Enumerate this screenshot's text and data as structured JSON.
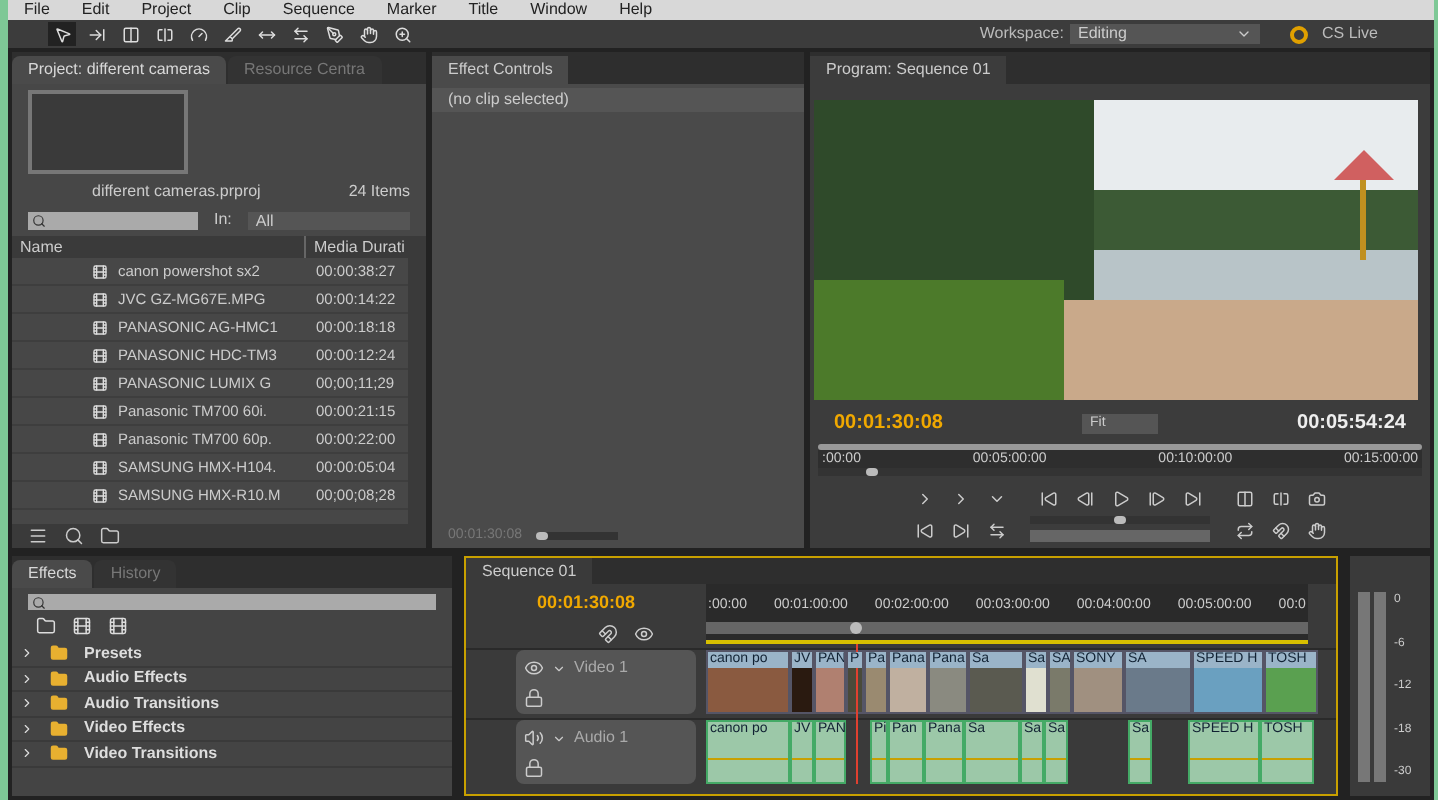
{
  "menu": [
    "File",
    "Edit",
    "Project",
    "Clip",
    "Sequence",
    "Marker",
    "Title",
    "Window",
    "Help"
  ],
  "tools": [
    {
      "kind": "select",
      "selected": true
    },
    {
      "kind": "track",
      "selected": false
    },
    {
      "kind": "ripple",
      "selected": false
    },
    {
      "kind": "rolling",
      "selected": false
    },
    {
      "kind": "rate",
      "selected": false
    },
    {
      "kind": "razor",
      "selected": false
    },
    {
      "kind": "slip",
      "selected": false
    },
    {
      "kind": "slide",
      "selected": false
    },
    {
      "kind": "pen",
      "selected": false
    },
    {
      "kind": "hand",
      "selected": false
    },
    {
      "kind": "zoom",
      "selected": false
    }
  ],
  "workspace": {
    "label": "Workspace:",
    "value": "Editing"
  },
  "cs_live": "CS Live",
  "project": {
    "tabs": [
      {
        "label": "Project: different cameras",
        "selected": true
      },
      {
        "label": "Resource Centra",
        "selected": false
      }
    ],
    "file": "different cameras.prproj",
    "count": "24 Items",
    "in_label": "In:",
    "in_value": "All",
    "columns": [
      "Name",
      "Media Durati"
    ],
    "rows": [
      {
        "name": "canon powershot sx2",
        "duration": "00:00:38:27"
      },
      {
        "name": "JVC GZ-MG67E.MPG",
        "duration": "00:00:14:22"
      },
      {
        "name": "PANASONIC AG-HMC1",
        "duration": "00:00:18:18"
      },
      {
        "name": "PANASONIC HDC-TM3",
        "duration": "00:00:12:24"
      },
      {
        "name": "PANASONIC LUMIX G",
        "duration": "00;00;11;29"
      },
      {
        "name": "Panasonic TM700 60i.",
        "duration": "00:00:21:15"
      },
      {
        "name": "Panasonic TM700 60p.",
        "duration": "00:00:22:00"
      },
      {
        "name": "SAMSUNG HMX-H104.",
        "duration": "00:00:05:04"
      },
      {
        "name": "SAMSUNG HMX-R10.M",
        "duration": "00;00;08;28"
      }
    ]
  },
  "effect_controls": {
    "tab": "Effect Controls",
    "status": "(no clip selected)",
    "timecode": "00:01:30:08",
    "zoom": {
      "level": 0.05
    }
  },
  "program": {
    "tab": "Program: Sequence 01",
    "timecode": "00:01:30:08",
    "fit": "Fit",
    "duration": "00:05:54:24",
    "ruler": [
      ":00:00",
      "00:05:00:00",
      "00:10:00:00",
      "00:15:00:00"
    ],
    "level": 0.09,
    "shuttle": {
      "level": 0.5
    }
  },
  "effects": {
    "tabs": [
      {
        "label": "Effects",
        "selected": true
      },
      {
        "label": "History",
        "selected": false
      }
    ],
    "folders": [
      "Presets",
      "Audio Effects",
      "Audio Transitions",
      "Video Effects",
      "Video Transitions"
    ]
  },
  "sequence": {
    "tab": "Sequence 01",
    "timecode": "00:01:30:08",
    "ruler": [
      ":00:00",
      "00:01:00:00",
      "00:02:00:00",
      "00:03:00:00",
      "00:04:00:00",
      "00:05:00:00",
      "00:0"
    ],
    "level": 0.25,
    "tracks": [
      {
        "kind": "video",
        "name": "Video 1",
        "clips": [
          {
            "kind": "clip",
            "label": "canon po"
          },
          {
            "kind": "clip",
            "label": "JV"
          },
          {
            "kind": "clip",
            "label": "PAN"
          },
          {
            "kind": "clip",
            "label": "P"
          },
          {
            "kind": "clip",
            "label": "Pa"
          },
          {
            "kind": "clip",
            "label": "Pana"
          },
          {
            "kind": "clip",
            "label": "Pana"
          },
          {
            "kind": "clip",
            "label": "Sa"
          },
          {
            "kind": "clip",
            "label": "Sa"
          },
          {
            "kind": "clip",
            "label": "SA"
          },
          {
            "kind": "clip",
            "label": "SONY"
          },
          {
            "kind": "clip",
            "label": "SA"
          },
          {
            "kind": "clip",
            "label": "SPEED H"
          },
          {
            "kind": "clip",
            "label": "TOSH"
          }
        ]
      },
      {
        "kind": "audio",
        "name": "Audio 1",
        "clips": [
          {
            "kind": "clip",
            "label": "canon po"
          },
          {
            "kind": "clip",
            "label": "JV"
          },
          {
            "kind": "clip",
            "label": "PAN"
          },
          {
            "kind": "gap"
          },
          {
            "kind": "clip",
            "label": "Pi"
          },
          {
            "kind": "clip",
            "label": "Pan"
          },
          {
            "kind": "clip",
            "label": "Pana"
          },
          {
            "kind": "clip",
            "label": "Sa"
          },
          {
            "kind": "clip",
            "label": "Sa"
          },
          {
            "kind": "clip",
            "label": "Sa"
          },
          {
            "kind": "gap"
          },
          {
            "kind": "clip",
            "label": "Sa"
          },
          {
            "kind": "gap"
          },
          {
            "kind": "clip",
            "label": "SPEED H"
          },
          {
            "kind": "clip",
            "label": "TOSH"
          }
        ]
      }
    ]
  },
  "meters": {
    "scale": [
      "0",
      "-6",
      "-12",
      "-18",
      "-30"
    ]
  }
}
